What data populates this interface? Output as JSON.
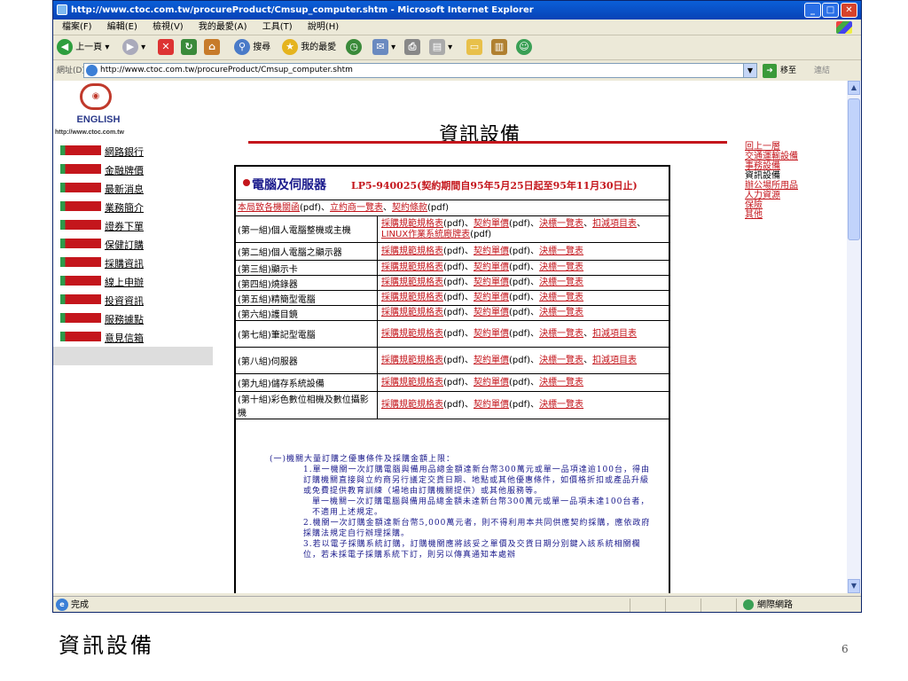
{
  "window": {
    "title": "http://www.ctoc.com.tw/procureProduct/Cmsup_computer.shtm - Microsoft Internet Explorer"
  },
  "menu": [
    "檔案(F)",
    "編輯(E)",
    "檢視(V)",
    "我的最愛(A)",
    "工具(T)",
    "說明(H)"
  ],
  "toolbar": {
    "back": "上一頁",
    "search": "搜尋",
    "favorites": "我的最愛"
  },
  "address": {
    "label": "網址(D)",
    "url": "http://www.ctoc.com.tw/procureProduct/Cmsup_computer.shtm",
    "go": "移至",
    "links": "連結"
  },
  "sidebar": {
    "english": "ENGLISH",
    "site_url": "http://www.ctoc.com.tw",
    "items": [
      "網路銀行",
      "金融牌價",
      "最新消息",
      "業務簡介",
      "證券下單",
      "保健訂購",
      "採購資訊",
      "線上申辦",
      "投資資訊",
      "服務據點",
      "意見信箱"
    ]
  },
  "page_title": "資訊設備",
  "right_nav": {
    "items": [
      {
        "label": "回上一層",
        "link": true
      },
      {
        "label": "交通運輸設備",
        "link": true
      },
      {
        "label": "事務設備",
        "link": true
      },
      {
        "label": "資訊設備",
        "link": false
      },
      {
        "label": "辦公場所用品",
        "link": true
      },
      {
        "label": "人力資源",
        "link": true
      },
      {
        "label": "保險",
        "link": true
      },
      {
        "label": "其他",
        "link": true
      }
    ]
  },
  "table": {
    "title": "電腦及伺服器",
    "subtitle": "LP5-940025(契約期間自95年5月25日起至95年11月30日止)",
    "intro": {
      "p1": "本局致各機關函",
      "p2": "(pdf)、",
      "p3": "立約商一覽表",
      "p4": "、",
      "p5": "契約條款",
      "p6": "(pdf)"
    },
    "rows": [
      {
        "group": "(第一組)個人電腦整機或主機",
        "parts": [
          {
            "t": "採購規範規格表",
            "l": true
          },
          {
            "t": "(pdf)、",
            "l": false
          },
          {
            "t": "契約單價",
            "l": true
          },
          {
            "t": "(pdf)、",
            "l": false
          },
          {
            "t": "決標一覽表",
            "l": true
          },
          {
            "t": "、",
            "l": false
          },
          {
            "t": "扣減項目表",
            "l": true
          },
          {
            "t": "、",
            "l": false
          },
          {
            "t": "LINUX作業系統廠牌表",
            "l": true
          },
          {
            "t": "(pdf)",
            "l": false
          }
        ]
      },
      {
        "group": "(第二組)個人電腦之顯示器",
        "parts": [
          {
            "t": "採購規範規格表",
            "l": true
          },
          {
            "t": "(pdf)、",
            "l": false
          },
          {
            "t": "契約單價",
            "l": true
          },
          {
            "t": "(pdf)、",
            "l": false
          },
          {
            "t": "決標一覽表",
            "l": true
          }
        ]
      },
      {
        "group": "(第三組)顯示卡",
        "parts": [
          {
            "t": "採購規範規格表",
            "l": true
          },
          {
            "t": "(pdf)、",
            "l": false
          },
          {
            "t": "契約單價",
            "l": true
          },
          {
            "t": "(pdf)、",
            "l": false
          },
          {
            "t": "決標一覽表",
            "l": true
          }
        ]
      },
      {
        "group": "(第四組)燒錄器",
        "parts": [
          {
            "t": "採購規範規格表",
            "l": true
          },
          {
            "t": "(pdf)、",
            "l": false
          },
          {
            "t": "契約單價",
            "l": true
          },
          {
            "t": "(pdf)、",
            "l": false
          },
          {
            "t": "決標一覽表",
            "l": true
          }
        ]
      },
      {
        "group": "(第五組)精簡型電腦",
        "parts": [
          {
            "t": "採購規範規格表",
            "l": true
          },
          {
            "t": "(pdf)、",
            "l": false
          },
          {
            "t": "契約單價",
            "l": true
          },
          {
            "t": "(pdf)、",
            "l": false
          },
          {
            "t": "決標一覽表",
            "l": true
          }
        ]
      },
      {
        "group": "(第六組)護目鏡",
        "parts": [
          {
            "t": "採購規範規格表",
            "l": true
          },
          {
            "t": "(pdf)、",
            "l": false
          },
          {
            "t": "契約單價",
            "l": true
          },
          {
            "t": "(pdf)、",
            "l": false
          },
          {
            "t": "決標一覽表",
            "l": true
          }
        ]
      },
      {
        "group": "(第七組)筆記型電腦",
        "parts": [
          {
            "t": "採購規範規格表",
            "l": true
          },
          {
            "t": "(pdf)、",
            "l": false
          },
          {
            "t": "契約單價",
            "l": true
          },
          {
            "t": "(pdf)、",
            "l": false
          },
          {
            "t": "決標一覽表",
            "l": true
          },
          {
            "t": "、",
            "l": false
          },
          {
            "t": "扣減項目表",
            "l": true
          }
        ]
      },
      {
        "group": "(第八組)伺服器",
        "parts": [
          {
            "t": "採購規範規格表",
            "l": true
          },
          {
            "t": "(pdf)、",
            "l": false
          },
          {
            "t": "契約單價",
            "l": true
          },
          {
            "t": "(pdf)、",
            "l": false
          },
          {
            "t": "決標一覽表",
            "l": true
          },
          {
            "t": "、",
            "l": false
          },
          {
            "t": "扣減項目表",
            "l": true
          }
        ]
      },
      {
        "group": "(第九組)儲存系統設備",
        "parts": [
          {
            "t": "採購規範規格表",
            "l": true
          },
          {
            "t": "(pdf)、",
            "l": false
          },
          {
            "t": "契約單價",
            "l": true
          },
          {
            "t": "(pdf)、",
            "l": false
          },
          {
            "t": "決標一覽表",
            "l": true
          }
        ]
      },
      {
        "group": "(第十組)彩色數位相機及數位攝影機",
        "parts": [
          {
            "t": "採購規範規格表",
            "l": true
          },
          {
            "t": "(pdf)、",
            "l": false
          },
          {
            "t": "契約單價",
            "l": true
          },
          {
            "t": "(pdf)、",
            "l": false
          },
          {
            "t": "決標一覽表",
            "l": true
          }
        ]
      }
    ],
    "notes": {
      "n0": "(一)機關大量訂購之優惠條件及採購金額上限：",
      "n1": "1.單一機關一次訂購電腦與備用品總金額達新台幣300萬元或單一品項達逾100台，得由訂購機關直接與立約商另行議定交貨日期、地點或其他優惠條件，如價格折扣或產品升級或免費提供教育訓練（場地由訂購機關提供）或其他服務等。",
      "n2": "單一機關一次訂購電腦與備用品總金額未達新台幣300萬元或單一品項未達100台者，不適用上述規定。",
      "n3": "2.機關一次訂購金額達新台幣5,000萬元者，則不得利用本共同供應契約採購，應依政府採購法規定自行辦理採購。",
      "n4": "3.若以電子採購系統訂購，訂購機關應將該妥之單價及交貨日期分別鍵入該系統相關欄位，若未採電子採購系統下訂，則另以傳真通知本處辦"
    }
  },
  "status": {
    "left": "完成",
    "zone": "網際網路"
  },
  "slide": {
    "caption": "資訊設備",
    "page": "6"
  }
}
